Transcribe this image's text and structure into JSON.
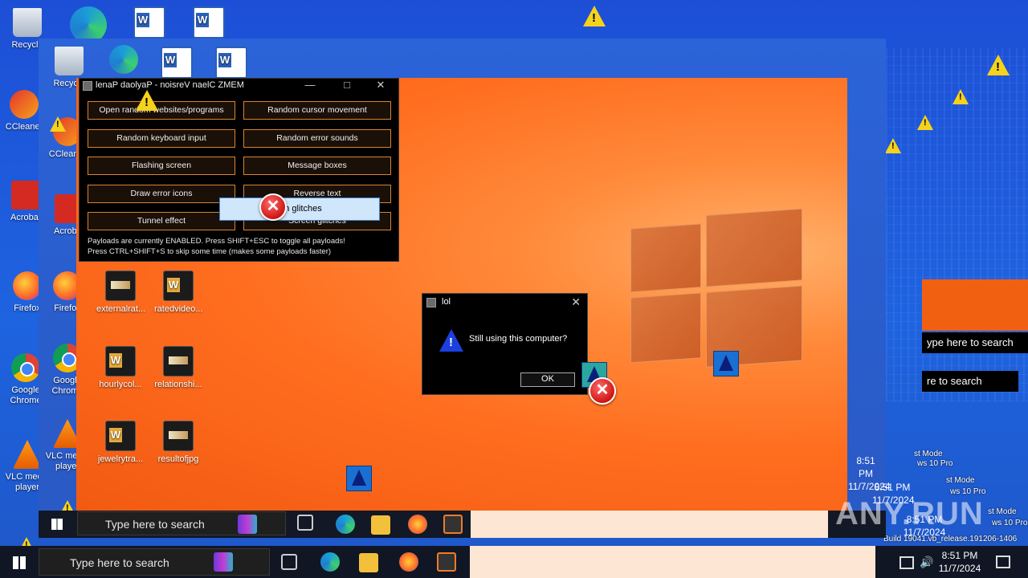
{
  "desktop_icons": {
    "recycle": "Recycle",
    "recycle2": "Recycle",
    "ccleaner": "CCleaner",
    "ccleaner2": "CCleaner",
    "acrobat": "Acrobat",
    "acrobat2": "Acrobat",
    "firefox": "Firefox",
    "firefox2": "Firefox",
    "chrome": "Google Chrome",
    "chrome2": "Google Chrome",
    "vlc": "VLC media player",
    "vlc2": "VLC media player",
    "file1": "externalrat...",
    "file2": "ratedvideo...",
    "file3": "hourlycol...",
    "file4": "relationshi...",
    "file5": "jewelrytra...",
    "file6": "resultofjpg"
  },
  "payload_window": {
    "title": "lenaP daolyaP - noisreV naelC ZMEM",
    "buttons": [
      "Open random websites/programs",
      "Random cursor movement",
      "Random keyboard input",
      "Random error sounds",
      "Flashing screen",
      "Message boxes",
      "Draw error icons",
      "Reverse text",
      "Tunnel effect",
      "Screen glitches"
    ],
    "status_line1": "Payloads are currently ENABLED. Press SHIFT+ESC to toggle all payloads!",
    "status_line2": "Press CTRL+SHIFT+S to skip some time (makes some payloads faster)",
    "ghost_button": "een glitches"
  },
  "lol_dialog": {
    "title": "lol",
    "message": "Still using this computer?",
    "ok_label": "OK"
  },
  "taskbar": {
    "search_placeholder": "Type here to search",
    "time": "8:51 PM",
    "date": "11/7/2024"
  },
  "taskbar_echo": {
    "search_placeholder": "Type here to search",
    "time": "8:51 PM",
    "date": "11/7/2024"
  },
  "right_panel": {
    "search1": "ype here to search",
    "search2": "re to search",
    "build1": "st Mode",
    "build2": "ws 10 Pro",
    "build3": "Build 19041.vb_release.191206-1406",
    "clock_small_time": "8:51 PM",
    "clock_small_date": "11/7/2024"
  },
  "watermark": "ANY.RUN"
}
